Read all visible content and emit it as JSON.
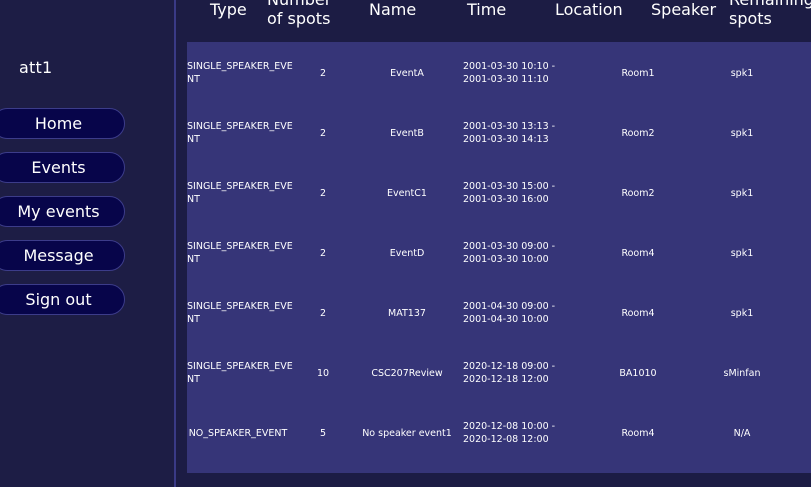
{
  "sidebar": {
    "user": "att1",
    "nav": [
      "Home",
      "Events",
      "My events",
      "Message",
      "Sign out"
    ]
  },
  "table": {
    "headers": {
      "type": "Type",
      "spots_line1": "Number",
      "spots_line2": "of spots",
      "name": "Name",
      "time": "Time",
      "location": "Location",
      "speaker": "Speaker",
      "remaining_line1": "Remaining",
      "remaining_line2": "spots"
    },
    "rows": [
      {
        "type": "SINGLE_SPEAKER_EVENT",
        "spots": "2",
        "name": "EventA",
        "time_start": "2001-03-30 10:10 -",
        "time_end": "2001-03-30 11:10",
        "location": "Room1",
        "speaker": "spk1"
      },
      {
        "type": "SINGLE_SPEAKER_EVENT",
        "spots": "2",
        "name": "EventB",
        "time_start": "2001-03-30 13:13 -",
        "time_end": "2001-03-30 14:13",
        "location": "Room2",
        "speaker": "spk1"
      },
      {
        "type": "SINGLE_SPEAKER_EVENT",
        "spots": "2",
        "name": "EventC1",
        "time_start": "2001-03-30 15:00 -",
        "time_end": "2001-03-30 16:00",
        "location": "Room2",
        "speaker": "spk1"
      },
      {
        "type": "SINGLE_SPEAKER_EVENT",
        "spots": "2",
        "name": "EventD",
        "time_start": "2001-03-30 09:00 -",
        "time_end": "2001-03-30 10:00",
        "location": "Room4",
        "speaker": "spk1"
      },
      {
        "type": "SINGLE_SPEAKER_EVENT",
        "spots": "2",
        "name": "MAT137",
        "time_start": "2001-04-30 09:00 -",
        "time_end": "2001-04-30 10:00",
        "location": "Room4",
        "speaker": "spk1"
      },
      {
        "type": "SINGLE_SPEAKER_EVENT",
        "spots": "10",
        "name": "CSC207Review",
        "time_start": "2020-12-18 09:00 -",
        "time_end": "2020-12-18 12:00",
        "location": "BA1010",
        "speaker": "sMinfan"
      },
      {
        "type": "NO_SPEAKER_EVENT",
        "spots": "5",
        "name": "No speaker event1",
        "time_start": "2020-12-08 10:00 -",
        "time_end": "2020-12-08 12:00",
        "location": "Room4",
        "speaker": "N/A"
      }
    ]
  }
}
